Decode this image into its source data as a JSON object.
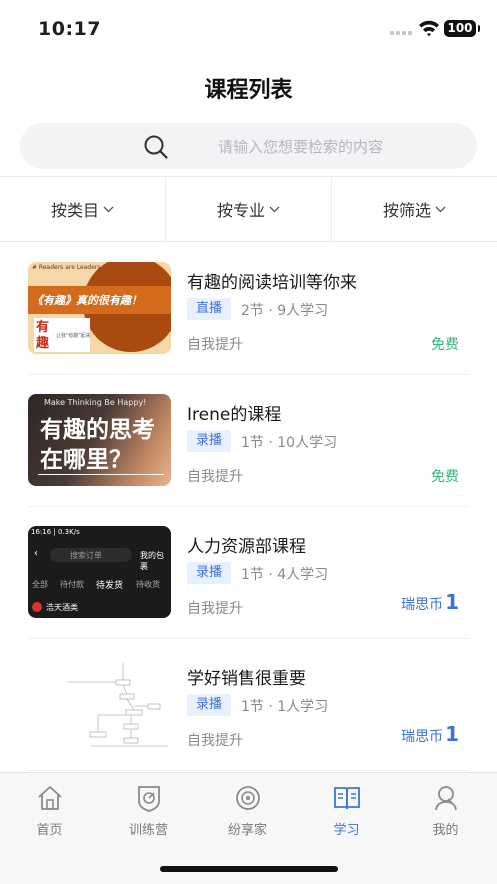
{
  "status": {
    "time": "10:17",
    "battery": "100"
  },
  "header": {
    "title": "课程列表"
  },
  "search": {
    "placeholder": "请输入您想要检索的内容"
  },
  "filters": [
    "按类目",
    "按专业",
    "按筛选"
  ],
  "courses": [
    {
      "title": "有趣的阅读培训等你来",
      "tag": "直播",
      "meta": "2节 ·  9人学习",
      "category": "自我提升",
      "price": "免费",
      "thumb": {
        "top": "# Readers are Leaders",
        "headline": "《有趣》真的很有趣！",
        "side": "有趣",
        "note": "让我\"有趣\"起来"
      }
    },
    {
      "title": "Irene的课程",
      "tag": "录播",
      "meta": "1节 ·  10人学习",
      "category": "自我提升",
      "price": "免费",
      "thumb": {
        "top": "Make Thinking Be Happy!",
        "line1": "有趣的思考",
        "line2": "在哪里？"
      }
    },
    {
      "title": "人力资源部课程",
      "tag": "录播",
      "meta": "1节 ·  4人学习",
      "category": "自我提升",
      "price_label": "瑞思币",
      "price_num": "1",
      "thumb": {
        "status": "16:16 | 0.3K/s",
        "search": "搜索订单",
        "right": "我的包裹",
        "tabs": [
          "全部",
          "待付款",
          "待发货",
          "待收货"
        ],
        "shop": "浩天酒类"
      }
    },
    {
      "title": "学好销售很重要",
      "tag": "录播",
      "meta": "1节 ·  1人学习",
      "category": "自我提升",
      "price_label": "瑞思币",
      "price_num": "1"
    }
  ],
  "tabs": [
    {
      "label": "首页",
      "icon": "home-icon",
      "active": false
    },
    {
      "label": "训练营",
      "icon": "badge-icon",
      "active": false
    },
    {
      "label": "纷享家",
      "icon": "disc-icon",
      "active": false
    },
    {
      "label": "学习",
      "icon": "book-icon",
      "active": true
    },
    {
      "label": "我的",
      "icon": "user-icon",
      "active": false
    }
  ],
  "colors": {
    "accent": "#3f73d9",
    "free": "#33b77a",
    "tag_bg": "#e8f0fd"
  }
}
